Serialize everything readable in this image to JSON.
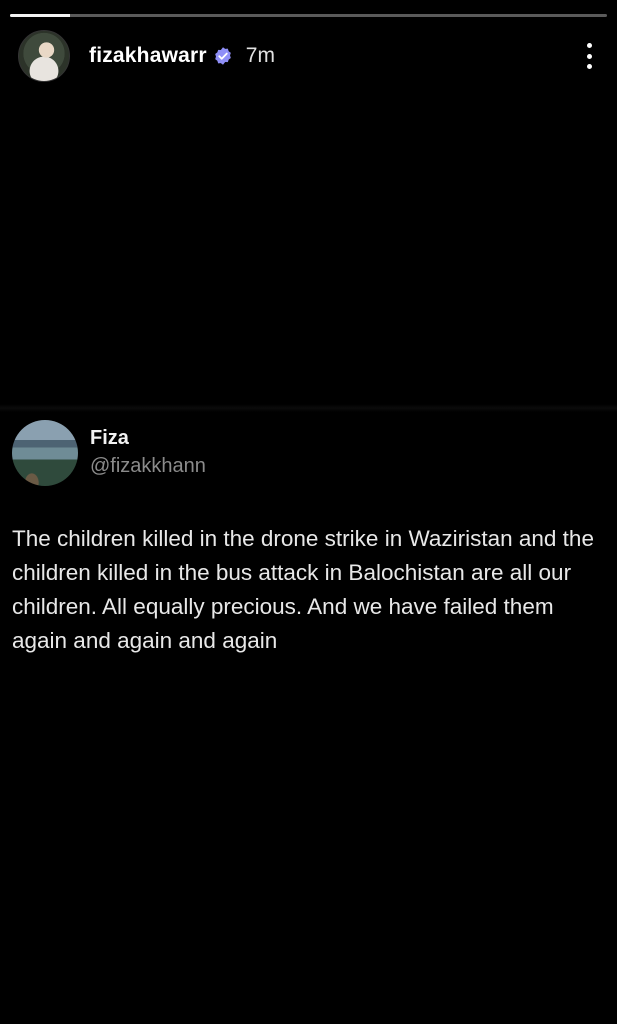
{
  "story": {
    "progress": 0.1,
    "username": "fizakhawarr",
    "verified": true,
    "time_ago": "7m",
    "icons": {
      "verified": "verified-badge-icon",
      "more": "more-vertical-icon"
    }
  },
  "tweet": {
    "display_name": "Fiza",
    "handle": "@fizakkhann",
    "text": "The children killed in the drone strike in Waziristan and the children killed in the bus attack in Balochistan are all our children. All equally precious. And we have failed them again and again and again"
  },
  "colors": {
    "background": "#000000",
    "verified_badge": "#8f8ff7"
  }
}
